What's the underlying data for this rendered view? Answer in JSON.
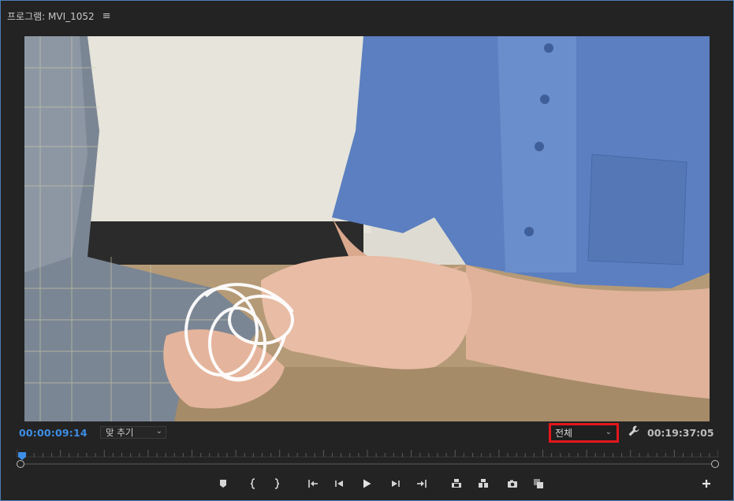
{
  "panel": {
    "title": "프로그램: MVI_1052",
    "menu_icon": "hamburger-menu-icon"
  },
  "controls": {
    "current_timecode": "00:00:09:14",
    "zoom_select": "맞 추기",
    "quality_select": "전체",
    "settings_icon": "wrench-icon",
    "duration_timecode": "00:19:37:05"
  },
  "playback": {
    "position_fraction": 0.005
  },
  "transport_icons": [
    "add-marker-icon",
    "mark-in-icon",
    "mark-out-icon",
    "go-to-in-icon",
    "step-back-icon",
    "play-icon",
    "step-forward-icon",
    "go-to-out-icon",
    "lift-icon",
    "extract-icon",
    "export-frame-icon",
    "comparison-view-icon",
    "add-button-icon"
  ],
  "colors": {
    "accent_blue": "#3d8ee6",
    "highlight_red": "#e3161c",
    "panel_border": "#4a7fb5"
  }
}
